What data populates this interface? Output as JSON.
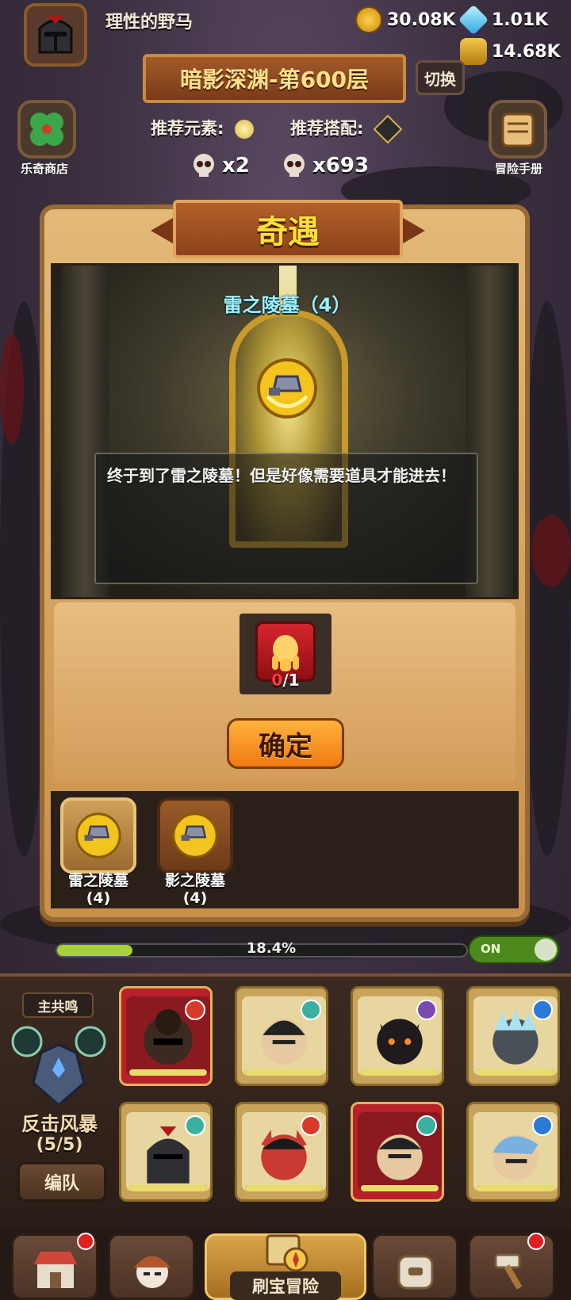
{
  "player": {
    "name": "理性的野马"
  },
  "resources": {
    "gold": "30.08K",
    "gems": "1.01K",
    "bottle": "14.68K"
  },
  "stage": {
    "title": "暗影深渊-第600层",
    "switch_label": "切换"
  },
  "recommend": {
    "element_label": "推荐元素:",
    "match_label": "推荐搭配:"
  },
  "skulls": {
    "small": "x2",
    "large": "x693"
  },
  "side": {
    "shop_label": "乐奇商店",
    "manual_label": "冒险手册"
  },
  "modal": {
    "title": "奇遇",
    "scene_title": "雷之陵墓（4）",
    "dialog_text": "终于到了雷之陵墓！但是好像需要道具才能进去！",
    "required_have": "0",
    "required_need": "/1",
    "confirm_label": "确定",
    "tabs": [
      {
        "label": "雷之陵墓",
        "sub": "(4)",
        "active": true
      },
      {
        "label": "影之陵墓",
        "sub": "(4)",
        "active": false
      }
    ]
  },
  "progress": {
    "percent_text": "18.4%",
    "fraction": 0.184,
    "toggle_label": "ON"
  },
  "team": {
    "leader_label": "主共鸣",
    "formation_name": "反击风暴",
    "formation_count": "(5/5)",
    "edit_label": "编队"
  },
  "bottom_nav": {
    "active_label": "刷宝冒险"
  },
  "colors": {
    "accent_gold": "#ffe03a",
    "scene_title": "#9ff0ff",
    "confirm": "#f07a12",
    "warning_red": "#ff3b3b"
  }
}
